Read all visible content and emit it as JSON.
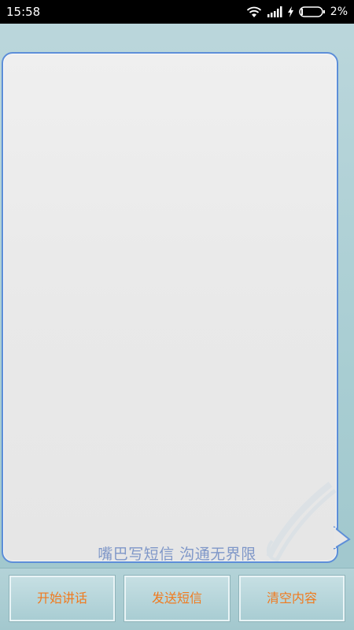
{
  "status_bar": {
    "time": "15:58",
    "battery_percent": "2%",
    "icons": [
      "wifi-icon",
      "signal-icon",
      "charging-icon",
      "battery-icon"
    ]
  },
  "main": {
    "slogan": "嘴巴写短信 沟通无界限"
  },
  "actions": {
    "start_talk": "开始讲话",
    "send_sms": "发送短信",
    "clear_content": "清空内容"
  },
  "colors": {
    "accent_text": "#f07a1e",
    "bubble_border": "#5d8ed8",
    "slogan": "#7f97c8",
    "background": "#a8cdd2"
  }
}
